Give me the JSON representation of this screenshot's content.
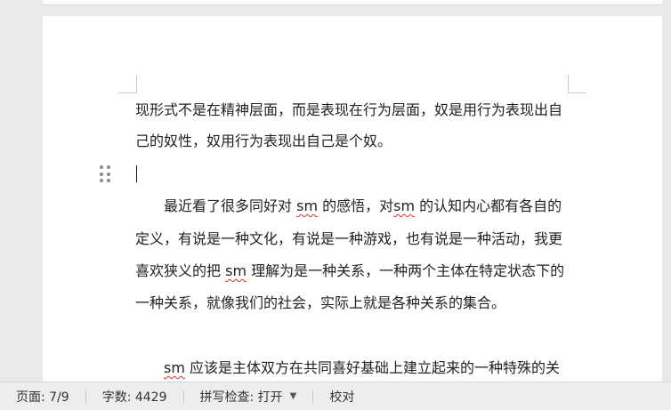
{
  "document": {
    "line1": "现形式不是在精神层面，而是表现在行为层面，奴是用行为表现出自",
    "line2": "己的奴性，奴用行为表现出自己是个奴。",
    "para2": {
      "l3a": "最近看了很多同好对",
      "l3b": "sm",
      "l3c": "的感悟，对",
      "l3d": "sm",
      "l3e": "的认知内心都有各自的",
      "l4": "定义，有说是一种文化，有说是一种游戏，也有说是一种活动，我更",
      "l5a": "喜欢狭义的把",
      "l5b": "sm",
      "l5c": "理解为是一种关系，一种两个主体在特定状态下的",
      "l6": "一种关系，就像我们的社会，实际上就是各种关系的集合。"
    },
    "para3": {
      "l7a": "sm",
      "l7b": "应该是主体双方在共同喜好基础上建立起来的一种特殊的关"
    }
  },
  "statusbar": {
    "page": "页面: 7/9",
    "wordcount": "字数: 4429",
    "spellcheck": "拼写检查: 打开",
    "proofread": "校对"
  },
  "icons": {
    "drag_handle": "drag-handle-icon",
    "spellcheck_menu": "chevron-down-icon"
  },
  "colors": {
    "spelling_underline": "#e0312d"
  }
}
